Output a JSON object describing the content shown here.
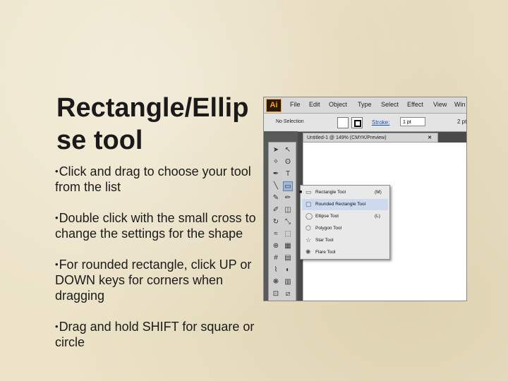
{
  "slide": {
    "title": "Rectangle/Ellipse tool",
    "bullets": [
      "Click and drag to choose your tool from the list",
      "Double click with the small cross to change the settings for the shape",
      "For rounded rectangle, click UP or DOWN keys for corners when dragging",
      "Drag and hold SHIFT for square or circle"
    ],
    "bullet_symbol": "•"
  },
  "screenshot": {
    "app_logo": "Ai",
    "menu": [
      "File",
      "Edit",
      "Object",
      "Type",
      "Select",
      "Effect",
      "View",
      "Win"
    ],
    "control_bar": {
      "selection": "No Selection",
      "stroke_label": "Stroke:",
      "stroke_value": "1 pt",
      "point_value": "2 pt"
    },
    "doc_tab": "Untitled-1 @ 149% (CMYK/Preview)",
    "doc_close": "✕",
    "flyout": [
      {
        "icon": "rectangle-tool-icon",
        "glyph": "▭",
        "label": "Rectangle Tool",
        "key": "(M)"
      },
      {
        "icon": "rounded-rectangle-tool-icon",
        "glyph": "▢",
        "label": "Rounded Rectangle Tool",
        "key": ""
      },
      {
        "icon": "ellipse-tool-icon",
        "glyph": "◯",
        "label": "Ellipse Tool",
        "key": "(L)"
      },
      {
        "icon": "polygon-tool-icon",
        "glyph": "⬡",
        "label": "Polygon Tool",
        "key": ""
      },
      {
        "icon": "star-tool-icon",
        "glyph": "☆",
        "label": "Star Tool",
        "key": ""
      },
      {
        "icon": "flare-tool-icon",
        "glyph": "✺",
        "label": "Flare Tool",
        "key": ""
      }
    ]
  }
}
